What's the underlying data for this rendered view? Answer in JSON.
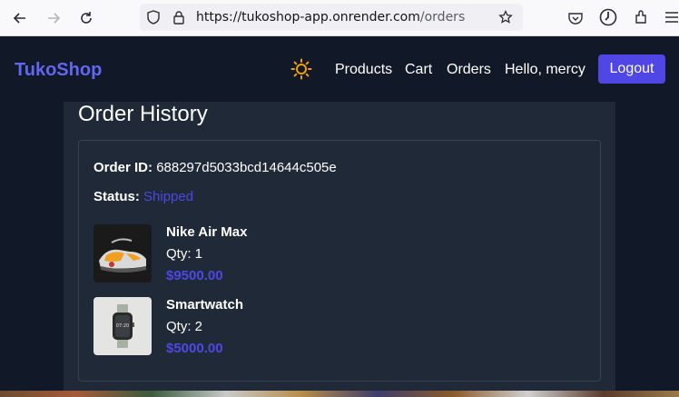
{
  "browser": {
    "url_host": "https://tukoshop-app.onrender.com",
    "url_path": "/orders"
  },
  "header": {
    "brand": "TukoShop",
    "nav": [
      "Products",
      "Cart",
      "Orders",
      "Hello, mercy"
    ],
    "logout_label": "Logout",
    "theme_icon": "sun-icon"
  },
  "main": {
    "title": "Order History",
    "order": {
      "id_label": "Order ID:",
      "id_value": "688297d5033bcd14644c505e",
      "status_label": "Status:",
      "status_value": "Shipped",
      "items": [
        {
          "name": "Nike Air Max",
          "qty": "Qty: 1",
          "price": "$9500.00"
        },
        {
          "name": "Smartwatch",
          "qty": "Qty: 2",
          "price": "$5000.00"
        }
      ]
    }
  },
  "colors": {
    "brand": "#6366f1",
    "accent": "#4f46e5",
    "bg": "#111827",
    "panel": "#1f2937"
  }
}
